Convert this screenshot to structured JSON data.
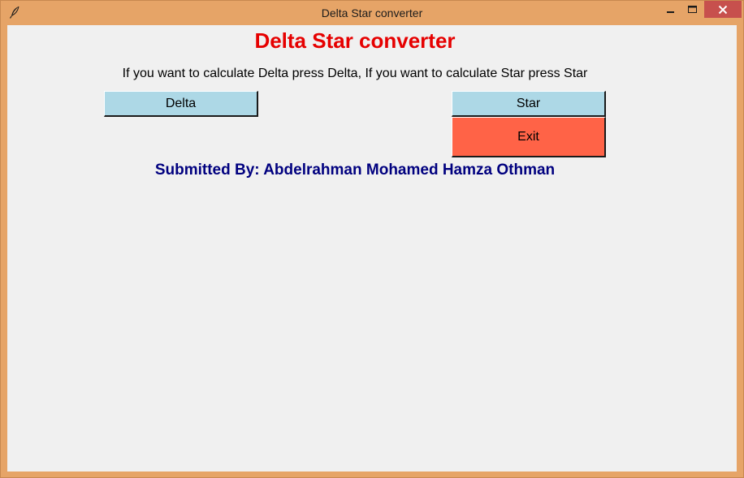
{
  "window": {
    "title": "Delta Star converter",
    "app_icon": "feather-icon",
    "controls": {
      "minimize_icon": "minimize-icon",
      "maximize_icon": "maximize-icon",
      "close_icon": "close-icon"
    },
    "frame_color": "#e6a467",
    "close_color": "#c7504d"
  },
  "main": {
    "heading": "Delta Star converter",
    "heading_color": "#e60000",
    "instruction": "If you want to calculate Delta press Delta, If you want to calculate Star press Star",
    "buttons": {
      "delta_label": "Delta",
      "star_label": "Star",
      "exit_label": "Exit"
    },
    "button_color": "#add8e6",
    "exit_color": "#ff6347",
    "submitted_by": "Submitted By: Abdelrahman Mohamed Hamza Othman",
    "submitted_color": "#00007f"
  }
}
